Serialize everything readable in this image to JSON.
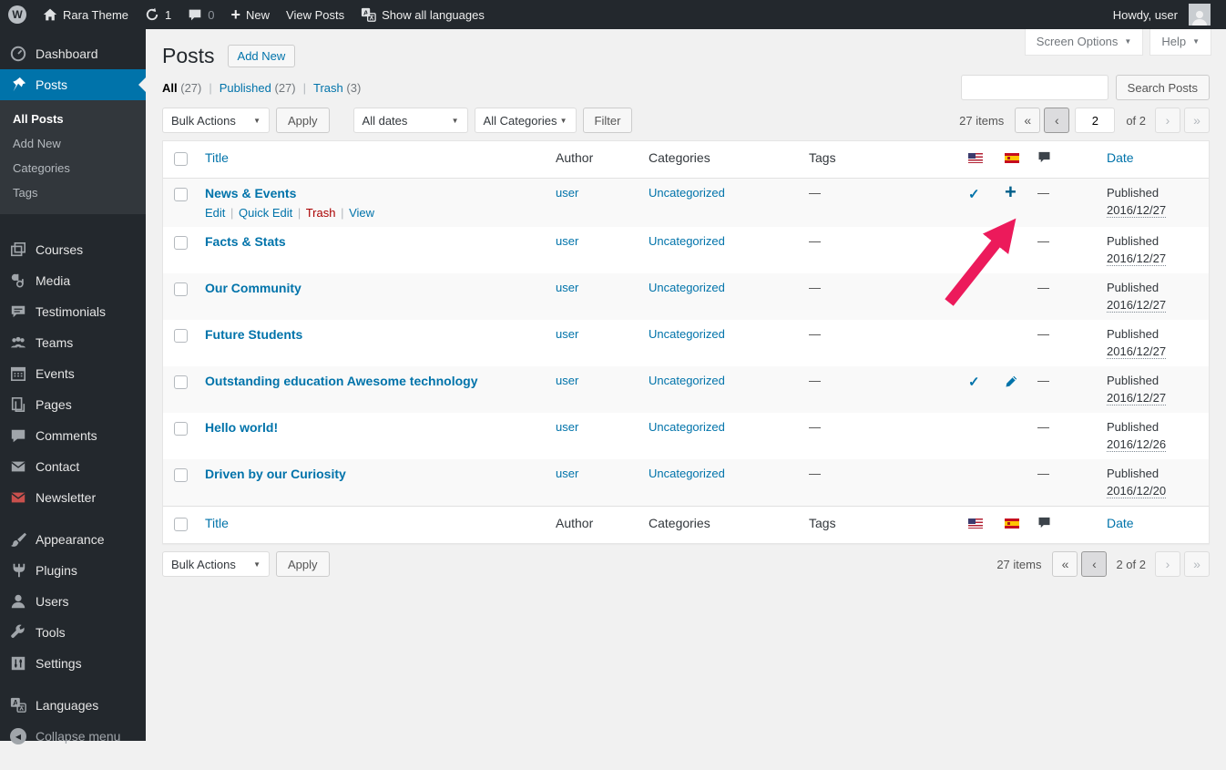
{
  "admin_bar": {
    "site_name": "Rara Theme",
    "updates_count": "1",
    "comments_count": "0",
    "new_label": "New",
    "view_posts": "View Posts",
    "show_all_languages": "Show all languages",
    "howdy": "Howdy, user"
  },
  "screen_meta": {
    "screen_options": "Screen Options",
    "help": "Help"
  },
  "page": {
    "title": "Posts",
    "add_new": "Add New"
  },
  "views": {
    "all": "All",
    "all_count": "(27)",
    "published": "Published",
    "published_count": "(27)",
    "trash": "Trash",
    "trash_count": "(3)"
  },
  "filters": {
    "bulk_actions": "Bulk Actions",
    "apply": "Apply",
    "all_dates": "All dates",
    "all_categories": "All Categories",
    "filter": "Filter"
  },
  "search": {
    "button": "Search Posts"
  },
  "pagination": {
    "top": {
      "items": "27 items",
      "current": "2",
      "of": "of 2"
    },
    "bottom": {
      "items": "27 items",
      "page": "2 of 2"
    }
  },
  "table": {
    "columns": {
      "title": "Title",
      "author": "Author",
      "categories": "Categories",
      "tags": "Tags",
      "date": "Date"
    },
    "rows": [
      {
        "title": "News & Events",
        "author": "user",
        "categories": "Uncategorized",
        "tags": "—",
        "comments": "—",
        "status": "Published",
        "date": "2016/12/27",
        "actions": {
          "edit": "Edit",
          "quick_edit": "Quick Edit",
          "trash": "Trash",
          "view": "View"
        }
      },
      {
        "title": "Facts & Stats",
        "author": "user",
        "categories": "Uncategorized",
        "tags": "—",
        "comments": "—",
        "status": "Published",
        "date": "2016/12/27"
      },
      {
        "title": "Our Community",
        "author": "user",
        "categories": "Uncategorized",
        "tags": "—",
        "comments": "—",
        "status": "Published",
        "date": "2016/12/27"
      },
      {
        "title": "Future Students",
        "author": "user",
        "categories": "Uncategorized",
        "tags": "—",
        "comments": "—",
        "status": "Published",
        "date": "2016/12/27"
      },
      {
        "title": "Outstanding education Awesome technology",
        "author": "user",
        "categories": "Uncategorized",
        "tags": "—",
        "comments": "—",
        "status": "Published",
        "date": "2016/12/27"
      },
      {
        "title": "Hello world!",
        "author": "user",
        "categories": "Uncategorized",
        "tags": "—",
        "comments": "—",
        "status": "Published",
        "date": "2016/12/26"
      },
      {
        "title": "Driven by our Curiosity",
        "author": "user",
        "categories": "Uncategorized",
        "tags": "—",
        "comments": "—",
        "status": "Published",
        "date": "2016/12/20"
      }
    ]
  },
  "sidebar": {
    "items": [
      {
        "label": "Dashboard"
      },
      {
        "label": "Posts"
      },
      {
        "label": "Courses"
      },
      {
        "label": "Media"
      },
      {
        "label": "Testimonials"
      },
      {
        "label": "Teams"
      },
      {
        "label": "Events"
      },
      {
        "label": "Pages"
      },
      {
        "label": "Comments"
      },
      {
        "label": "Contact"
      },
      {
        "label": "Newsletter"
      },
      {
        "label": "Appearance"
      },
      {
        "label": "Plugins"
      },
      {
        "label": "Users"
      },
      {
        "label": "Tools"
      },
      {
        "label": "Settings"
      },
      {
        "label": "Languages"
      }
    ],
    "submenu": {
      "all_posts": "All Posts",
      "add_new": "Add New",
      "categories": "Categories",
      "tags": "Tags"
    },
    "collapse": "Collapse menu"
  },
  "icons": {
    "wp": "W",
    "pipe": "|",
    "caret": "▼",
    "check": "✓",
    "plus": "+",
    "first": "«",
    "prev": "‹",
    "next": "›",
    "last": "»",
    "collapse_arrow": "◀"
  },
  "colors": {
    "accent": "#0073aa",
    "menu_bg": "#23282d",
    "annotation_arrow": "#ec1a5b",
    "trash_link": "#a00"
  }
}
